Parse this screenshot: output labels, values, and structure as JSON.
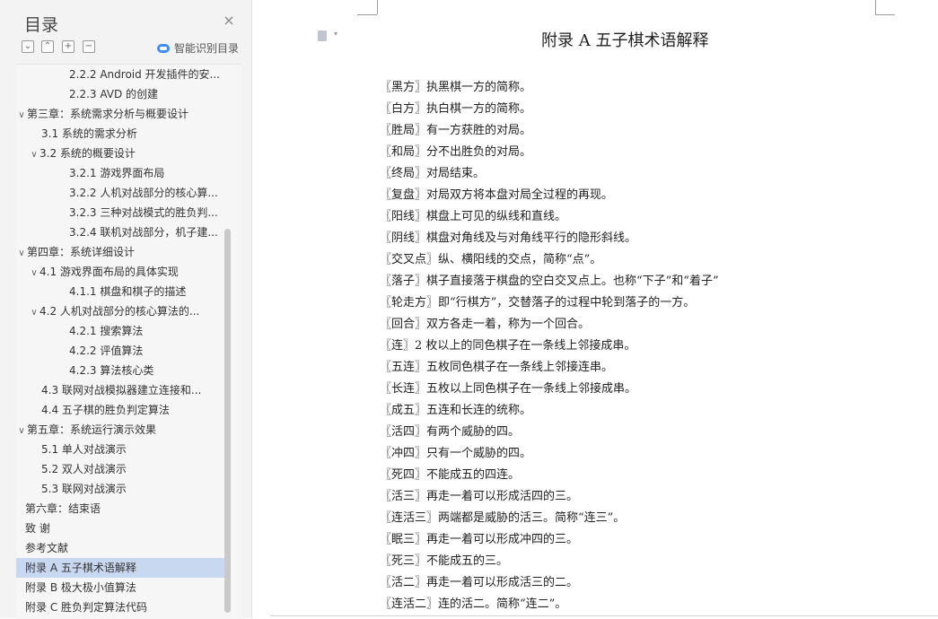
{
  "toc": {
    "title": "目录",
    "close_icon": "×",
    "tools": [
      "⌄",
      "⌃",
      "+",
      "−"
    ],
    "smart_label": "智能识别目录",
    "items": [
      {
        "text": "2.2.2 Android 开发插件的安...",
        "level": 3,
        "caret": ""
      },
      {
        "text": "2.2.3 AVD 的创建",
        "level": 3,
        "caret": ""
      },
      {
        "text": "第三章：系统需求分析与概要设计",
        "level": 1,
        "caret": "∨"
      },
      {
        "text": "3.1  系统的需求分析",
        "level": 2,
        "caret": ""
      },
      {
        "text": "3.2  系统的概要设计",
        "level": 2,
        "caret": "∨"
      },
      {
        "text": "3.2.1  游戏界面布局",
        "level": 3,
        "caret": ""
      },
      {
        "text": "3.2.2  人机对战部分的核心算...",
        "level": 3,
        "caret": ""
      },
      {
        "text": "3.2.3  三种对战模式的胜负判...",
        "level": 3,
        "caret": ""
      },
      {
        "text": "3.2.4  联机对战部分，机子建...",
        "level": 3,
        "caret": ""
      },
      {
        "text": "第四章：系统详细设计",
        "level": 1,
        "caret": "∨"
      },
      {
        "text": "4.1  游戏界面布局的具体实现",
        "level": 2,
        "caret": "∨"
      },
      {
        "text": "4.1.1  棋盘和棋子的描述",
        "level": 3,
        "caret": ""
      },
      {
        "text": "4.2  人机对战部分的核心算法的...",
        "level": 2,
        "caret": "∨"
      },
      {
        "text": "4.2.1    搜索算法",
        "level": 3,
        "caret": ""
      },
      {
        "text": "4.2.2    评值算法",
        "level": 3,
        "caret": ""
      },
      {
        "text": "4.2.3    算法核心类",
        "level": 3,
        "caret": ""
      },
      {
        "text": "4.3  联网对战模拟器建立连接和...",
        "level": 2,
        "caret": ""
      },
      {
        "text": "4.4  五子棋的胜负判定算法",
        "level": 2,
        "caret": ""
      },
      {
        "text": "第五章：系统运行演示效果",
        "level": 1,
        "caret": "∨"
      },
      {
        "text": "5.1  单人对战演示",
        "level": 2,
        "caret": ""
      },
      {
        "text": "5.2  双人对战演示",
        "level": 2,
        "caret": ""
      },
      {
        "text": "5.3  联网对战演示",
        "level": 2,
        "caret": ""
      },
      {
        "text": "第六章：结束语",
        "level": 1,
        "caret": ""
      },
      {
        "text": "致    谢",
        "level": 1,
        "caret": ""
      },
      {
        "text": "参考文献",
        "level": 1,
        "caret": ""
      },
      {
        "text": "附录 A  五子棋术语解释",
        "level": 1,
        "caret": "",
        "selected": true
      },
      {
        "text": "附录 B  极大极小值算法",
        "level": 1,
        "caret": ""
      },
      {
        "text": "附录 C  胜负判定算法代码",
        "level": 1,
        "caret": ""
      }
    ]
  },
  "document": {
    "title": "附录 A  五子棋术语解释",
    "terms": [
      "〖黑方〗执黑棋一方的简称。",
      "〖白方〗执白棋一方的简称。",
      "〖胜局〗有一方获胜的对局。",
      "〖和局〗分不出胜负的对局。",
      "〖终局〗对局结束。",
      "〖复盘〗对局双方将本盘对局全过程的再现。",
      "〖阳线〗棋盘上可见的纵线和直线。",
      "〖阴线〗棋盘对角线及与对角线平行的隐形斜线。",
      "〖交叉点〗纵、横阳线的交点，简称“点”。",
      "〖落子〗棋子直接落于棋盘的空白交叉点上。也称“下子”和“着子”",
      "〖轮走方〗即“行棋方”，交替落子的过程中轮到落子的一方。",
      "〖回合〗双方各走一着，称为一个回合。",
      "〖连〗2 枚以上的同色棋子在一条线上邻接成串。",
      "〖五连〗五枚同色棋子在一条线上邻接连串。",
      "〖长连〗五枚以上同色棋子在一条线上邻接成串。",
      "〖成五〗五连和长连的统称。",
      "〖活四〗有两个威胁的四。",
      "〖冲四〗只有一个威胁的四。",
      "〖死四〗不能成五的四连。",
      "〖活三〗再走一着可以形成活四的三。",
      "〖连活三〗两端都是威胁的活三。简称“连三”。",
      "〖眠三〗再走一着可以形成冲四的三。",
      "〖死三〗不能成五的三。",
      "〖活二〗再走一着可以形成活三的二。",
      "〖连活二〗连的活二。简称“连二”。"
    ]
  },
  "colors": {
    "selected_bg": "#c9d8f1",
    "pane_bg": "#f3f3f3",
    "accent": "#3e8ef7"
  }
}
